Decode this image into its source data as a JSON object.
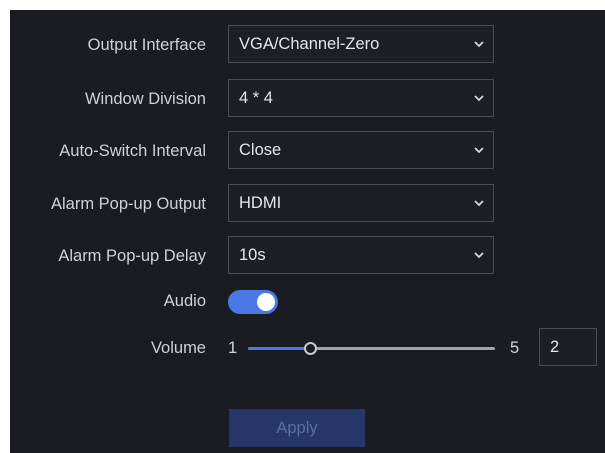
{
  "settings": {
    "output_interface": {
      "label": "Output Interface",
      "value": "VGA/Channel-Zero"
    },
    "window_division": {
      "label": "Window Division",
      "value": "4 * 4"
    },
    "auto_switch_interval": {
      "label": "Auto-Switch Interval",
      "value": "Close"
    },
    "alarm_popup_output": {
      "label": "Alarm Pop-up Output",
      "value": "HDMI"
    },
    "alarm_popup_delay": {
      "label": "Alarm Pop-up Delay",
      "value": "10s"
    },
    "audio": {
      "label": "Audio",
      "enabled": true
    },
    "volume": {
      "label": "Volume",
      "min": "1",
      "max": "5",
      "value": "2",
      "level": 2
    }
  },
  "apply_label": "Apply",
  "colors": {
    "panel_bg": "#1a1c21",
    "accent": "#4a78e6",
    "apply_bg": "#25376a"
  },
  "icons": {
    "dropdown": "chevron-down-icon"
  }
}
